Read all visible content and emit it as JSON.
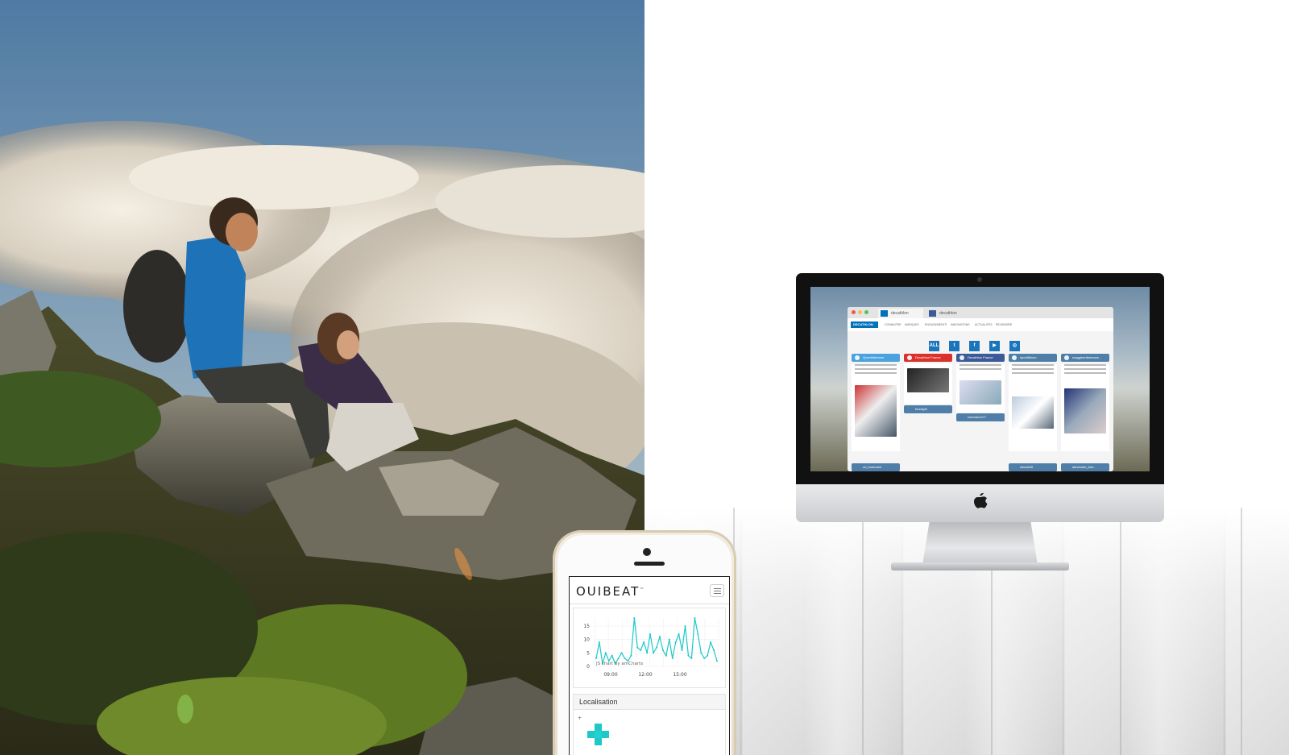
{
  "phone_app": {
    "brand": "OUIBEAT",
    "brand_mark": "™",
    "chart_credit": "JS chart by amCharts",
    "localisation_label": "Localisation",
    "menu_icon": "hamburger-menu-icon"
  },
  "chart_data": {
    "type": "line",
    "x_tick_labels": [
      "09:00",
      "12:00",
      "15:00"
    ],
    "y_tick_labels": [
      "15",
      "10",
      "5",
      "0"
    ],
    "ylim": [
      0,
      18
    ],
    "grid": true,
    "color": "#1ec8c8",
    "series": [
      {
        "values": [
          3,
          9,
          1,
          5,
          2,
          4,
          1,
          3,
          5,
          3,
          2,
          4,
          18,
          7,
          6,
          9,
          5,
          12,
          5,
          7,
          11,
          6,
          4,
          10,
          3,
          9,
          12,
          6,
          15,
          4,
          3,
          18,
          12,
          5,
          3,
          4,
          9,
          6,
          2
        ]
      }
    ]
  },
  "imac_screen": {
    "tabs": [
      {
        "label": "decathlon",
        "icon": "decathlon-logo-icon"
      },
      {
        "label": "decathlon",
        "icon": "facebook-icon"
      }
    ],
    "logo_text": "DECATHLON",
    "nav_items": [
      "CONNAITRE",
      "MARQUES",
      "ENGAGEMENTS",
      "INNOVATIONS",
      "ACTUALITES",
      "REJOINDRE"
    ],
    "filter_buttons": [
      "ALL",
      "t",
      "f",
      "▶",
      "◎"
    ],
    "columns": [
      {
        "title": "Quentinhenner",
        "color": "#4aa3df",
        "footer": "od_lourinaire"
      },
      {
        "title": "Decathlon France",
        "color": "#d9312c",
        "footer": "fundayel"
      },
      {
        "title": "Decathlon France",
        "color": "#3b5b98",
        "footer": "corinnerce77"
      },
      {
        "title": "sportifdixon",
        "color": "#4f7fa8",
        "footer": "clemia28"
      },
      {
        "title": "maggieonthemove...",
        "color": "#4f7fa8",
        "footer": "alexandre_bml..."
      }
    ]
  },
  "colors": {
    "accent_teal": "#1ec8c8",
    "decathlon_blue": "#0072bc"
  }
}
